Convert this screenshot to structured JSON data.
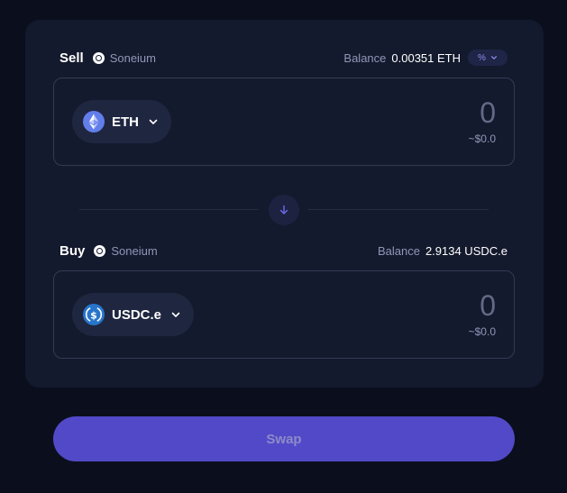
{
  "sell": {
    "label": "Sell",
    "chain": "Soneium",
    "balance_label": "Balance",
    "balance_value": "0.00351 ETH",
    "pct_label": "%",
    "token": "ETH",
    "token_icon": "ethereum-icon",
    "amount": "0",
    "usd": "~$0.0"
  },
  "buy": {
    "label": "Buy",
    "chain": "Soneium",
    "balance_label": "Balance",
    "balance_value": "2.9134 USDC.e",
    "token": "USDC.e",
    "token_icon": "usdc-icon",
    "amount": "0",
    "usd": "~$0.0"
  },
  "swap_button": {
    "label": "Swap"
  },
  "colors": {
    "background": "#0b0f1d",
    "card": "#141a2d",
    "accent": "#5249c8",
    "muted_text": "#8f96b8"
  }
}
